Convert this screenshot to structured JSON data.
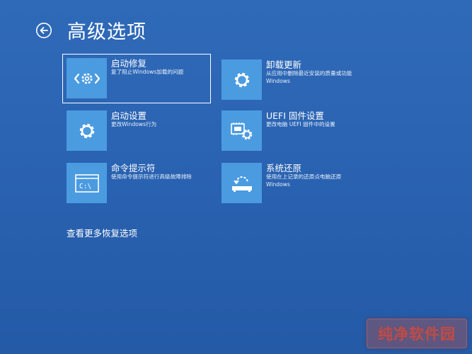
{
  "header": {
    "title": "高级选项",
    "back_icon": "back-arrow-circle-icon"
  },
  "colors": {
    "background": "#2a64b4",
    "tile": "#4b9be0",
    "text": "#ffffff",
    "selected_border": "#ffffff"
  },
  "options": [
    {
      "title": "启动修复",
      "desc": "复了阻止Windows加载的问题",
      "icon": "startup-repair-icon",
      "selected": true
    },
    {
      "title": "卸载更新",
      "desc": "从应用中删除最近安装的质量或功能Windows",
      "icon": "gear-icon",
      "selected": false
    },
    {
      "title": "启动设置",
      "desc": "更改Windows行为",
      "icon": "gear-icon",
      "selected": false
    },
    {
      "title": "UEFI 固件设置",
      "desc": "更改电脑 UEFI 固件中的设置",
      "icon": "uefi-firmware-icon",
      "selected": false
    },
    {
      "title": "命令提示符",
      "desc": "使用命令提示符进行高级故障排除",
      "icon": "command-prompt-icon",
      "icon_text": "C:\\",
      "selected": false
    },
    {
      "title": "系统还原",
      "desc": "使用在上记录的还原点电脑还原Windows",
      "icon": "system-restore-icon",
      "selected": false
    }
  ],
  "footer": {
    "more_options_label": "查看更多恢复选项"
  },
  "watermark": {
    "text": "纯净软件园"
  }
}
